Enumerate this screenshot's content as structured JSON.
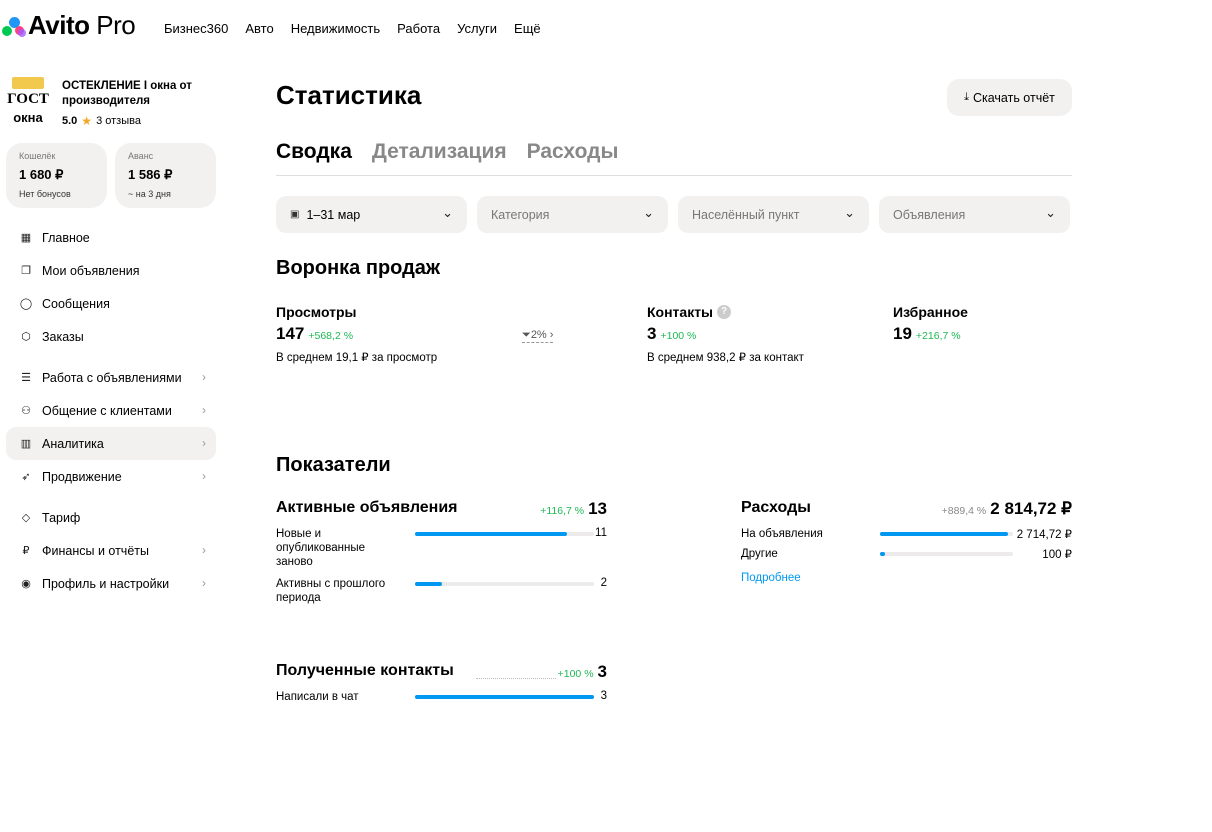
{
  "brand": {
    "name": "Avito",
    "suffix": "Pro"
  },
  "topnav": [
    "Бизнес360",
    "Авто",
    "Недвижимость",
    "Работа",
    "Услуги",
    "Ещё"
  ],
  "shop": {
    "logo_line1": "ГОСТ",
    "logo_line2": "окна",
    "name": "ОСТЕКЛЕНИЕ I окна от производителя",
    "rating": "5.0",
    "reviews": "3 отзыва"
  },
  "wallets": [
    {
      "label": "Кошелёк",
      "value": "1 680 ₽",
      "sub": "Нет бонусов"
    },
    {
      "label": "Аванс",
      "value": "1 586 ₽",
      "sub": "~ на 3 дня"
    }
  ],
  "menu": [
    {
      "label": "Главное",
      "icon": "grid-icon"
    },
    {
      "label": "Мои объявления",
      "icon": "copy-icon"
    },
    {
      "label": "Сообщения",
      "icon": "chat-icon"
    },
    {
      "label": "Заказы",
      "icon": "box-icon"
    },
    {
      "label": "Работа с объявлениями",
      "icon": "list-icon"
    },
    {
      "label": "Общение с клиентами",
      "icon": "users-icon"
    },
    {
      "label": "Аналитика",
      "icon": "chart-icon"
    },
    {
      "label": "Продвижение",
      "icon": "rocket-icon"
    },
    {
      "label": "Тариф",
      "icon": "diamond-icon"
    },
    {
      "label": "Финансы и отчёты",
      "icon": "ruble-icon"
    },
    {
      "label": "Профиль и настройки",
      "icon": "profile-icon"
    }
  ],
  "page": {
    "title": "Статистика",
    "download": "Скачать отчёт",
    "tabs": [
      "Сводка",
      "Детализация",
      "Расходы"
    ],
    "filters": [
      "1–31 мар",
      "Категория",
      "Населённый пункт",
      "Объявления"
    ]
  },
  "funnel": {
    "title": "Воронка продаж",
    "views": {
      "label": "Просмотры",
      "value": "147",
      "change": "+568,2 %",
      "sub": "В среднем 19,1 ₽ за просмотр"
    },
    "conversion": "2%",
    "contacts": {
      "label": "Контакты",
      "value": "3",
      "change": "+100 %",
      "sub": "В среднем 938,2 ₽ за контакт"
    },
    "favorites": {
      "label": "Избранное",
      "value": "19",
      "change": "+216,7 %"
    }
  },
  "indicators": {
    "title": "Показатели",
    "active": {
      "title": "Активные объявления",
      "change": "+116,7 %",
      "value": "13",
      "rows": [
        {
          "label": "Новые и опубликованные заново",
          "value": "11",
          "fill": 0.85
        },
        {
          "label": "Активны с прошлого периода",
          "value": "2",
          "fill": 0.15
        }
      ]
    },
    "expenses": {
      "title": "Расходы",
      "change": "+889,4 %",
      "value": "2 814,72 ₽",
      "rows": [
        {
          "label": "На объявления",
          "value": "2 714,72 ₽",
          "fill": 0.96
        },
        {
          "label": "Другие",
          "value": "100 ₽",
          "fill": 0.04
        }
      ],
      "more": "Подробнее"
    },
    "contacts": {
      "title": "Полученные контакты",
      "change": "+100 %",
      "value": "3",
      "rows": [
        {
          "label": "Написали в чат",
          "value": "3",
          "fill": 1.0
        }
      ]
    }
  },
  "colors": {
    "accent": "#0098f0",
    "positive": "#1db954",
    "surface": "#f2f1f0"
  }
}
